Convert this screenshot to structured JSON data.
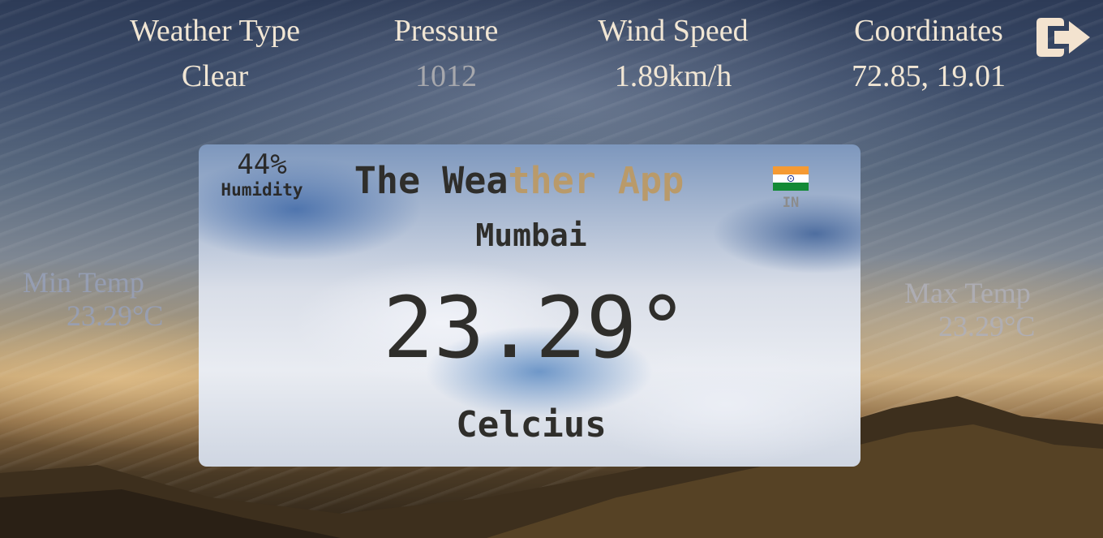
{
  "stats": {
    "weather_type": {
      "label": "Weather Type",
      "value": "Clear"
    },
    "pressure": {
      "label": "Pressure",
      "value": "1012"
    },
    "wind_speed": {
      "label": "Wind Speed",
      "value": "1.89km/h"
    },
    "coordinates": {
      "label": "Coordinates",
      "value": "72.85, 19.01"
    }
  },
  "logout": {
    "icon": "logout-icon"
  },
  "min_temp": {
    "label": "Min Temp",
    "value": "23.29°C"
  },
  "max_temp": {
    "label": "Max Temp",
    "value": "23.29°C"
  },
  "card": {
    "humidity_value": "44%",
    "humidity_label": "Humidity",
    "title_part1": "The Wea",
    "title_part2": "ther App",
    "country_code": "IN",
    "flag": "india-flag-icon",
    "city": "Mumbai",
    "temperature": "23.29°",
    "unit": "Celcius"
  },
  "colors": {
    "stat_text": "#f1e6d4",
    "card_text": "#2f2e2b",
    "title_accent": "#b99a6a"
  }
}
